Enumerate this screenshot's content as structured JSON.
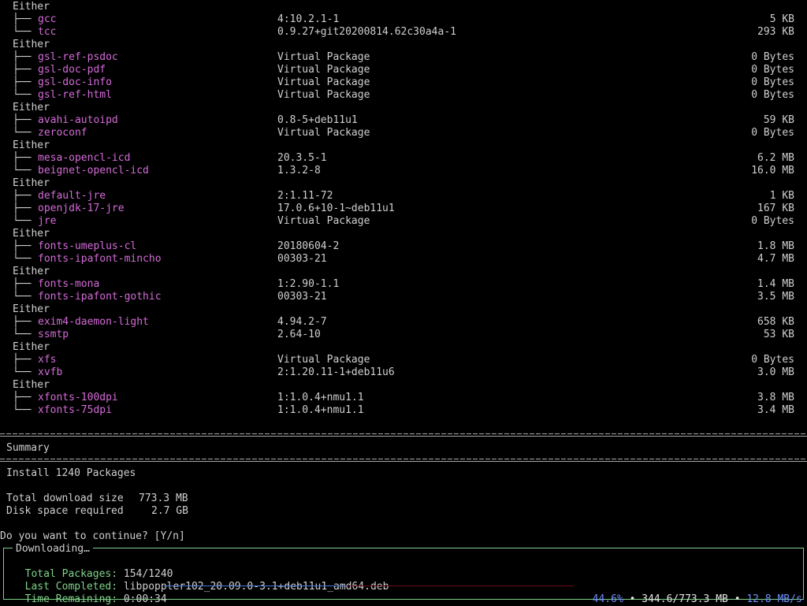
{
  "groups": [
    {
      "label": "Either",
      "packages": [
        {
          "tree": "├──",
          "name": "gcc",
          "version": "4:10.2.1-1",
          "size": "5 KB"
        },
        {
          "tree": "└──",
          "name": "tcc",
          "version": "0.9.27+git20200814.62c30a4a-1",
          "size": "293 KB"
        }
      ]
    },
    {
      "label": "Either",
      "packages": [
        {
          "tree": "├──",
          "name": "gsl-ref-psdoc",
          "version": "Virtual Package",
          "size": "0 Bytes"
        },
        {
          "tree": "├──",
          "name": "gsl-doc-pdf",
          "version": "Virtual Package",
          "size": "0 Bytes"
        },
        {
          "tree": "├──",
          "name": "gsl-doc-info",
          "version": "Virtual Package",
          "size": "0 Bytes"
        },
        {
          "tree": "└──",
          "name": "gsl-ref-html",
          "version": "Virtual Package",
          "size": "0 Bytes"
        }
      ]
    },
    {
      "label": "Either",
      "packages": [
        {
          "tree": "├──",
          "name": "avahi-autoipd",
          "version": "0.8-5+deb11u1",
          "size": "59 KB"
        },
        {
          "tree": "└──",
          "name": "zeroconf",
          "version": "Virtual Package",
          "size": "0 Bytes"
        }
      ]
    },
    {
      "label": "Either",
      "packages": [
        {
          "tree": "├──",
          "name": "mesa-opencl-icd",
          "version": "20.3.5-1",
          "size": "6.2 MB"
        },
        {
          "tree": "└──",
          "name": "beignet-opencl-icd",
          "version": "1.3.2-8",
          "size": "16.0 MB"
        }
      ]
    },
    {
      "label": "Either",
      "packages": [
        {
          "tree": "├──",
          "name": "default-jre",
          "version": "2:1.11-72",
          "size": "1 KB"
        },
        {
          "tree": "├──",
          "name": "openjdk-17-jre",
          "version": "17.0.6+10-1~deb11u1",
          "size": "167 KB"
        },
        {
          "tree": "└──",
          "name": "jre",
          "version": "Virtual Package",
          "size": "0 Bytes"
        }
      ]
    },
    {
      "label": "Either",
      "packages": [
        {
          "tree": "├──",
          "name": "fonts-umeplus-cl",
          "version": "20180604-2",
          "size": "1.8 MB"
        },
        {
          "tree": "└──",
          "name": "fonts-ipafont-mincho",
          "version": "00303-21",
          "size": "4.7 MB"
        }
      ]
    },
    {
      "label": "Either",
      "packages": [
        {
          "tree": "├──",
          "name": "fonts-mona",
          "version": "1:2.90-1.1",
          "size": "1.4 MB"
        },
        {
          "tree": "└──",
          "name": "fonts-ipafont-gothic",
          "version": "00303-21",
          "size": "3.5 MB"
        }
      ]
    },
    {
      "label": "Either",
      "packages": [
        {
          "tree": "├──",
          "name": "exim4-daemon-light",
          "version": "4.94.2-7",
          "size": "658 KB"
        },
        {
          "tree": "└──",
          "name": "ssmtp",
          "version": "2.64-10",
          "size": "53 KB"
        }
      ]
    },
    {
      "label": "Either",
      "packages": [
        {
          "tree": "├──",
          "name": "xfs",
          "version": "Virtual Package",
          "size": "0 Bytes"
        },
        {
          "tree": "└──",
          "name": "xvfb",
          "version": "2:1.20.11-1+deb11u6",
          "size": "3.0 MB"
        }
      ]
    },
    {
      "label": "Either",
      "packages": [
        {
          "tree": "├──",
          "name": "xfonts-100dpi",
          "version": "1:1.0.4+nmu1.1",
          "size": "3.8 MB"
        },
        {
          "tree": "└──",
          "name": "xfonts-75dpi",
          "version": "1:1.0.4+nmu1.1",
          "size": "3.4 MB"
        }
      ]
    }
  ],
  "summary": {
    "title": "Summary",
    "install_line": "Install 1240 Packages",
    "download_label": "Total download size",
    "download_value": "773.3 MB",
    "disk_label": "Disk space required",
    "disk_value": "2.7 GB",
    "prompt": "Do you want to continue? [Y/n]"
  },
  "downloading": {
    "title": "Downloading…",
    "total_label": "Total Packages:",
    "total_value": "154/1240",
    "last_label": "Last Completed:",
    "last_value": "libpoppler102_20.09.0-3.1+deb11u1_amd64.deb",
    "time_label": "Time Remaining:",
    "time_value": "0:00:34",
    "progress": 0.446,
    "percent": "44.6%",
    "bytes": "344.6/773.3 MB",
    "speed": "12.8 MB/s",
    "bullet": "•"
  },
  "colors": {
    "package_name": "#d46bd8",
    "box_border": "#7fd18a",
    "progress_done": "#4a78d8",
    "progress_remaining": "#6b0f1a"
  }
}
